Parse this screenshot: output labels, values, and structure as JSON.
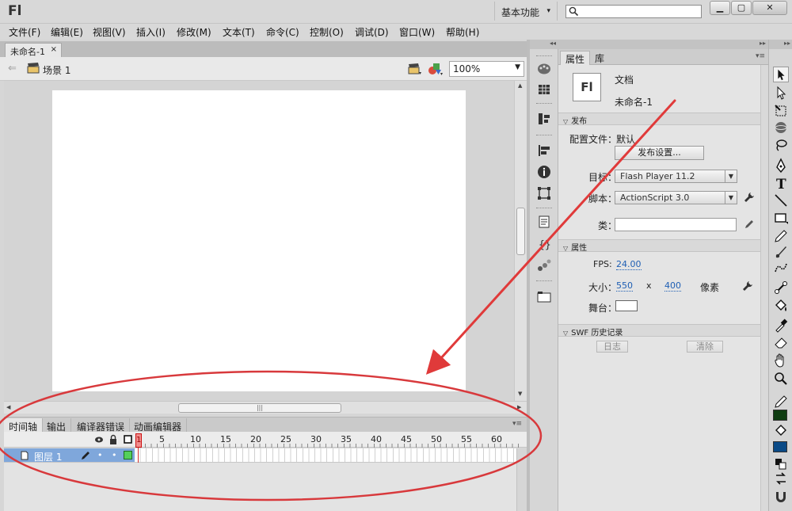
{
  "app": {
    "logo": "Fl",
    "workspace": "基本功能"
  },
  "menu": [
    "文件(F)",
    "编辑(E)",
    "视图(V)",
    "插入(I)",
    "修改(M)",
    "文本(T)",
    "命令(C)",
    "控制(O)",
    "调试(D)",
    "窗口(W)",
    "帮助(H)"
  ],
  "document": {
    "tab_title": "未命名-1",
    "tab_close": "×",
    "scene": "场景 1",
    "zoom": "100%"
  },
  "timeline": {
    "tabs": [
      "时间轴",
      "输出",
      "编译器错误",
      "动画编辑器"
    ],
    "frame_numbers": [
      "1",
      "5",
      "10",
      "15",
      "20",
      "25",
      "30",
      "35",
      "40",
      "45",
      "50",
      "55",
      "60"
    ],
    "layer_name": "图层 1"
  },
  "properties": {
    "tabs": [
      "属性",
      "库"
    ],
    "badge": "Fl",
    "doc_type": "文档",
    "doc_name": "未命名-1",
    "publish": {
      "header": "发布",
      "profile_label": "配置文件：",
      "profile_value": "默认",
      "settings_button": "发布设置...",
      "target_label": "目标：",
      "target_value": "Flash Player 11.2",
      "script_label": "脚本：",
      "script_value": "ActionScript 3.0",
      "class_label": "类："
    },
    "props_section": {
      "header": "属性",
      "fps_label": "FPS:",
      "fps_value": "24.00",
      "size_label": "大小：",
      "width": "550",
      "x": "x",
      "height": "400",
      "unit": "像素",
      "stage_label": "舞台："
    },
    "swf_history": {
      "header": "SWF 历史记录",
      "log_button": "日志",
      "clear_button": "清除"
    }
  },
  "colors": {
    "stroke": "#000000",
    "fill_top": "#0f3d12",
    "fill_bottom": "#0a4a86",
    "annotation": "#e03a3a"
  }
}
